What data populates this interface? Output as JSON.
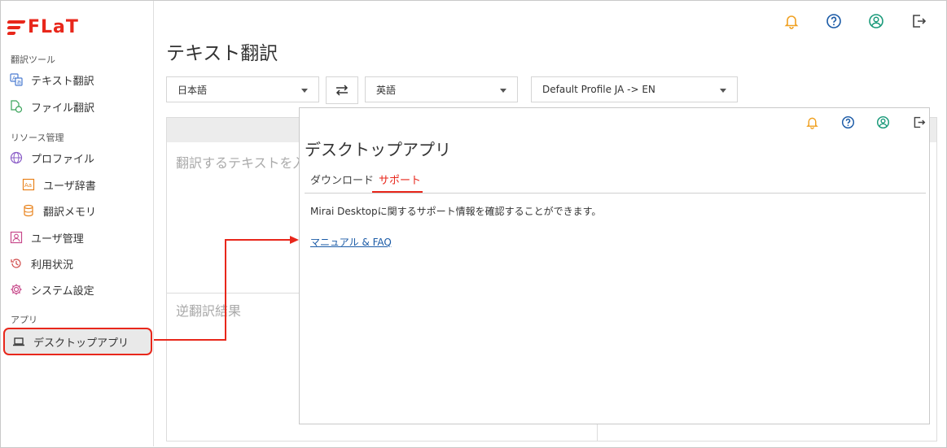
{
  "brand": {
    "logo_text": "FLaT",
    "color": "#e8271b"
  },
  "sidebar": {
    "sections": [
      "翻訳ツール",
      "リソース管理",
      "アプリ"
    ],
    "items": [
      {
        "label": "テキスト翻訳",
        "icon": "text-translate-icon"
      },
      {
        "label": "ファイル翻訳",
        "icon": "file-translate-icon"
      },
      {
        "label": "プロファイル",
        "icon": "globe-icon"
      },
      {
        "label": "ユーザ辞書",
        "icon": "dictionary-icon"
      },
      {
        "label": "翻訳メモリ",
        "icon": "database-icon"
      },
      {
        "label": "ユーザ管理",
        "icon": "user-card-icon"
      },
      {
        "label": "利用状況",
        "icon": "history-icon"
      },
      {
        "label": "システム設定",
        "icon": "gear-icon"
      },
      {
        "label": "デスクトップアプリ",
        "icon": "laptop-icon"
      }
    ]
  },
  "header_icons": [
    "bell-icon",
    "help-icon",
    "account-icon",
    "logout-icon"
  ],
  "main": {
    "title": "テキスト翻訳",
    "source_lang": "日本語",
    "target_lang": "英語",
    "profile": "Default Profile JA -> EN",
    "input_placeholder": "翻訳するテキストを入",
    "back_translation_label": "逆翻訳結果"
  },
  "overlay": {
    "title": "デスクトップアプリ",
    "tabs": [
      {
        "label": "ダウンロード",
        "active": false
      },
      {
        "label": "サポート",
        "active": true
      }
    ],
    "description": "Mirai Desktopに関するサポート情報を確認することができます。",
    "link": "マニュアル & FAQ"
  },
  "colors": {
    "accent": "#e8271b",
    "bell": "#f0a020",
    "help": "#1a5aa6",
    "account": "#1a9a7a",
    "link": "#1a5aa6"
  }
}
